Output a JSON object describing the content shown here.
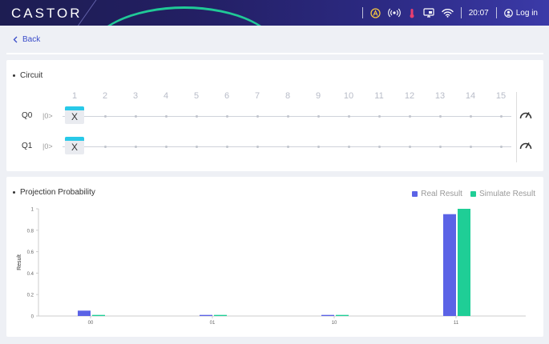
{
  "header": {
    "logo": "CASTOR",
    "time": "20:07",
    "login_label": "Log in",
    "icons": [
      "person-alert-icon",
      "broadcast-icon",
      "thermometer-icon",
      "monitor-icon",
      "wifi-icon",
      "user-circle-icon"
    ]
  },
  "nav": {
    "back_label": "Back"
  },
  "circuit": {
    "title": "Circuit",
    "columns": [
      "1",
      "2",
      "3",
      "4",
      "5",
      "6",
      "7",
      "8",
      "9",
      "10",
      "11",
      "12",
      "13",
      "14",
      "15"
    ],
    "qubits": [
      {
        "label": "Q0",
        "init": "|0>",
        "gate": "X"
      },
      {
        "label": "Q1",
        "init": "|0>",
        "gate": "X"
      }
    ]
  },
  "probability": {
    "title": "Projection Probability",
    "legend": {
      "real": "Real Result",
      "simulate": "Simulate Result"
    }
  },
  "colors": {
    "real": "#5b63e6",
    "simulate": "#1fce96",
    "accent": "#3a4cc9"
  },
  "chart_data": {
    "type": "bar",
    "title": "Projection Probability",
    "categories": [
      "00",
      "01",
      "10",
      "11"
    ],
    "series": [
      {
        "name": "Real Result",
        "values": [
          0.05,
          0.01,
          0.01,
          0.95
        ]
      },
      {
        "name": "Simulate Result",
        "values": [
          0.01,
          0.01,
          0.01,
          1.0
        ]
      }
    ],
    "ylabel": "Result",
    "xlabel": "",
    "yticks": [
      "0",
      "0.2",
      "0.4",
      "0.6",
      "0.8",
      "1"
    ],
    "ylim": [
      0,
      1
    ],
    "grid": false,
    "legend": "top-right"
  }
}
